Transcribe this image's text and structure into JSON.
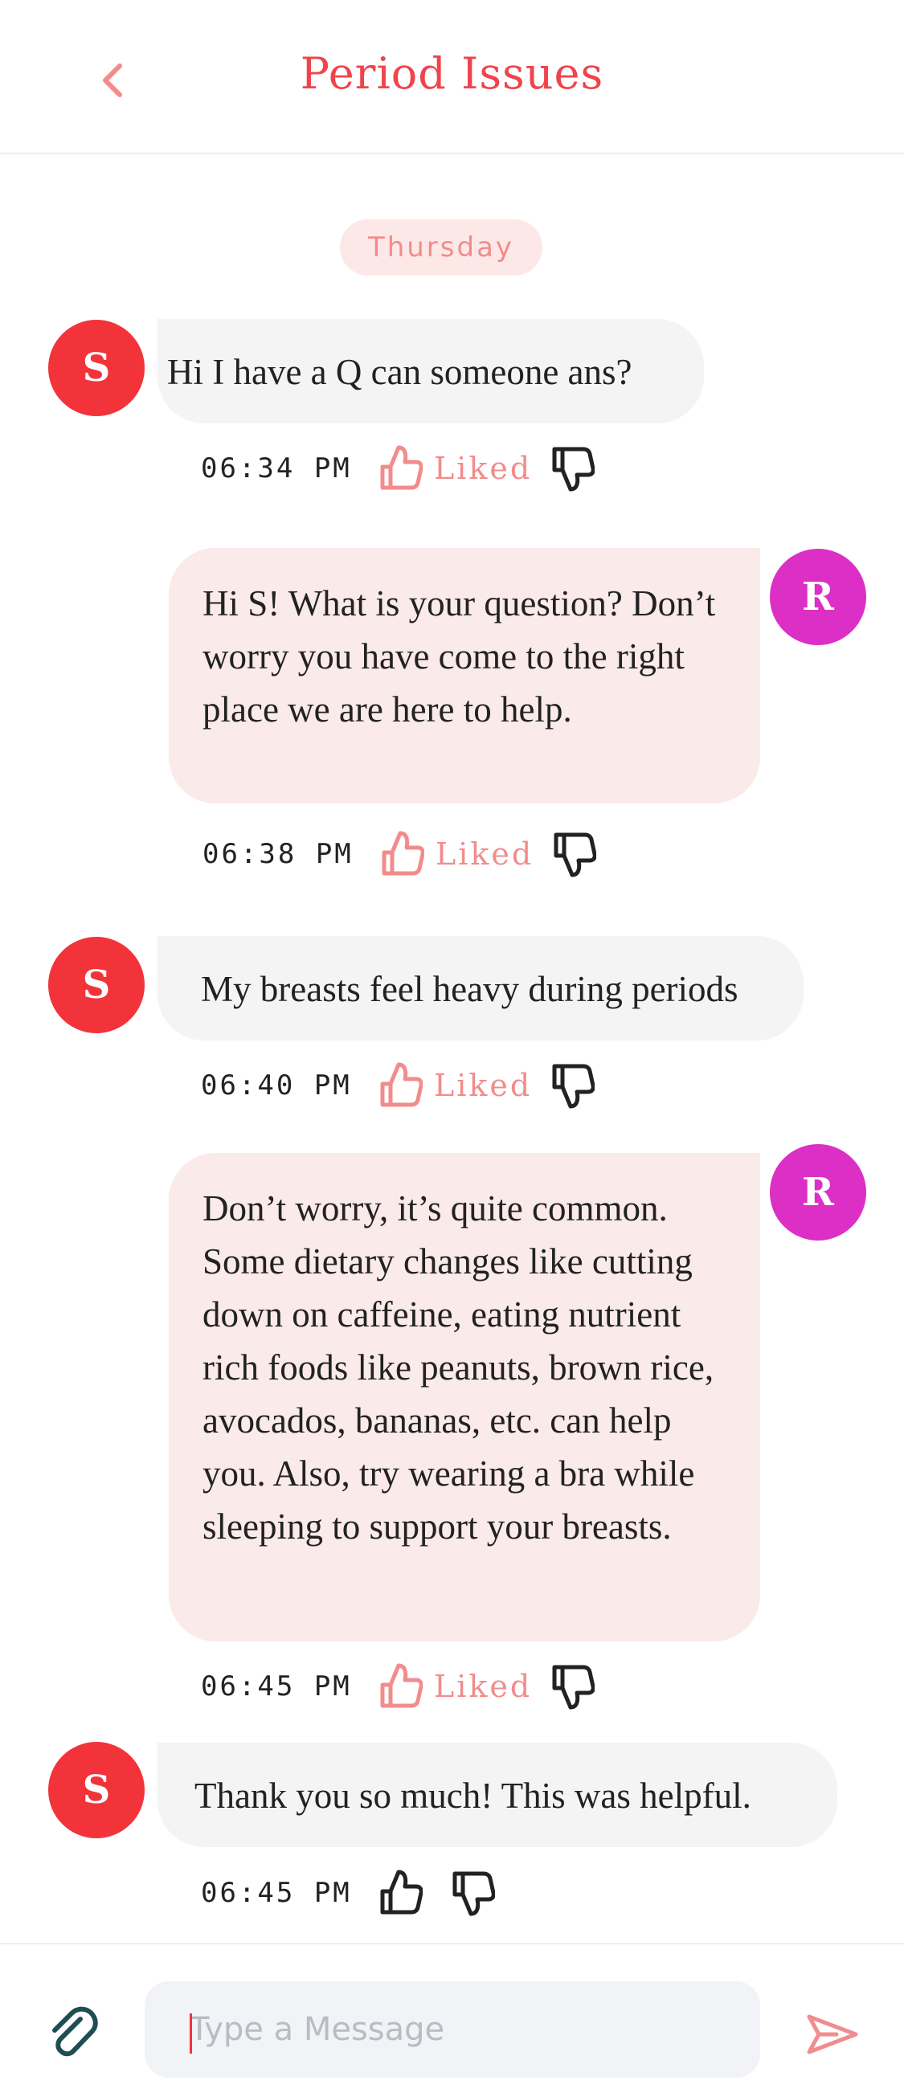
{
  "header": {
    "title": "Period Issues",
    "back_icon": "chevron-left-icon"
  },
  "day_label": "Thursday",
  "colors": {
    "accent": "#f0444c",
    "avatar_s": "#f2333a",
    "avatar_r": "#dc2fc6",
    "outgoing_bubble": "#fbeaea",
    "incoming_bubble": "#f4f4f4",
    "liked": "#f28c8c"
  },
  "messages": [
    {
      "avatar": "S",
      "text": "Hi I have a Q can someone ans?",
      "time": "06:34 PM",
      "liked_label": "Liked"
    },
    {
      "avatar": "R",
      "text": "Hi S! What is your question? Don’t worry you have come to the right place we are here to help.",
      "time": "06:38 PM",
      "liked_label": "Liked"
    },
    {
      "avatar": "S",
      "text": "My breasts feel heavy during periods",
      "time": "06:40 PM",
      "liked_label": "Liked"
    },
    {
      "avatar": "R",
      "text": "Don’t worry, it’s quite common. Some dietary changes like cutting down on caffeine, eating nutrient rich foods like peanuts, brown rice, avocados, bananas, etc. can help you. Also, try wearing a bra while sleeping to support your breasts.",
      "time": "06:45 PM",
      "liked_label": "Liked"
    },
    {
      "avatar": "S",
      "text": "Thank you so much! This was helpful.",
      "time": "06:45 PM",
      "liked_label": ""
    }
  ],
  "input": {
    "placeholder": "Type a Message",
    "value": ""
  },
  "icons": {
    "attach": "paperclip-icon",
    "send": "send-icon",
    "like": "thumbs-up-icon",
    "dislike": "thumbs-down-icon"
  }
}
